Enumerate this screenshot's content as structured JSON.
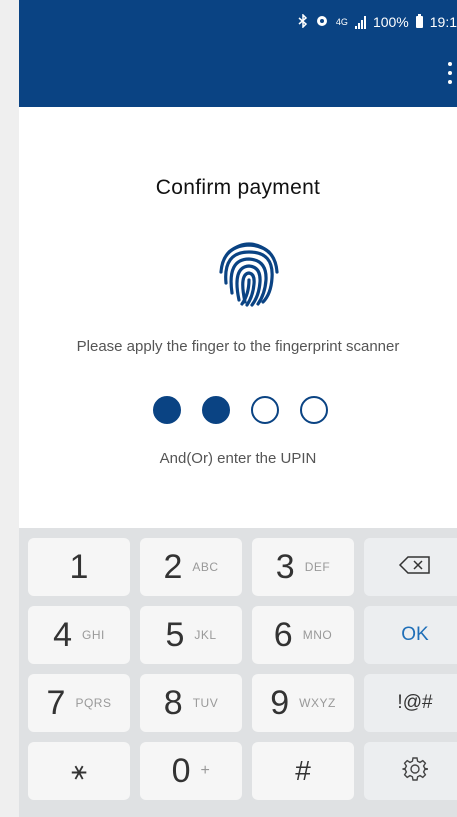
{
  "status_bar": {
    "network": "4G",
    "battery": "100%",
    "time": "19:1"
  },
  "header": {
    "background": "#0a4383"
  },
  "main": {
    "title": "Confirm payment",
    "fingerprint_hint": "Please apply the finger to the fingerprint scanner",
    "pin_dots": {
      "total": 4,
      "filled": 2
    },
    "upin_hint": "And(Or) enter the UPIN"
  },
  "keypad": {
    "keys": [
      {
        "main": "1",
        "sub": ""
      },
      {
        "main": "2",
        "sub": "ABC"
      },
      {
        "main": "3",
        "sub": "DEF"
      },
      {
        "main": "4",
        "sub": "GHI"
      },
      {
        "main": "5",
        "sub": "JKL"
      },
      {
        "main": "6",
        "sub": "MNO"
      },
      {
        "main": "7",
        "sub": "PQRS"
      },
      {
        "main": "8",
        "sub": "TUV"
      },
      {
        "main": "9",
        "sub": "WXYZ"
      },
      {
        "main": "⚹",
        "sub": ""
      },
      {
        "main": "0",
        "sub": "+"
      },
      {
        "main": "#",
        "sub": ""
      }
    ],
    "ok_label": "OK",
    "symbols_label": "!@#",
    "backspace_icon": "backspace-icon",
    "settings_icon": "settings-gear-icon"
  }
}
